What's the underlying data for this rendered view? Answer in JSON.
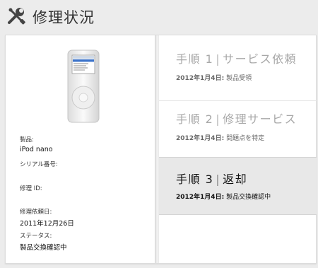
{
  "header": {
    "title": "修理状況",
    "icon": "tools-icon"
  },
  "device": {
    "image": "ipod-nano-image",
    "product_label": "製品:",
    "product_value": "iPod nano",
    "serial_label": "シリアル番号:",
    "serial_value": "",
    "repair_id_label": "修理 ID:",
    "repair_id_value": "",
    "request_date_label": "修理依頼日:",
    "request_date_value": "2011年12月26日",
    "status_label": "ステータス:",
    "status_value": "製品交換確認中"
  },
  "steps": [
    {
      "name": "手順 1",
      "title": "サービス依頼",
      "date": "2012年1月4日:",
      "detail": "製品受領",
      "active": false
    },
    {
      "name": "手順 2",
      "title": "修理サービス",
      "date": "2012年1月4日:",
      "detail": "問題点を特定",
      "active": false
    },
    {
      "name": "手順 3",
      "title": "返却",
      "date": "2012年1月4日:",
      "detail": "製品交換確認中",
      "active": true
    }
  ],
  "colors": {
    "background": "#ececec",
    "inactive_text": "#a8a8a8",
    "active_bg": "#e8e8e8"
  }
}
